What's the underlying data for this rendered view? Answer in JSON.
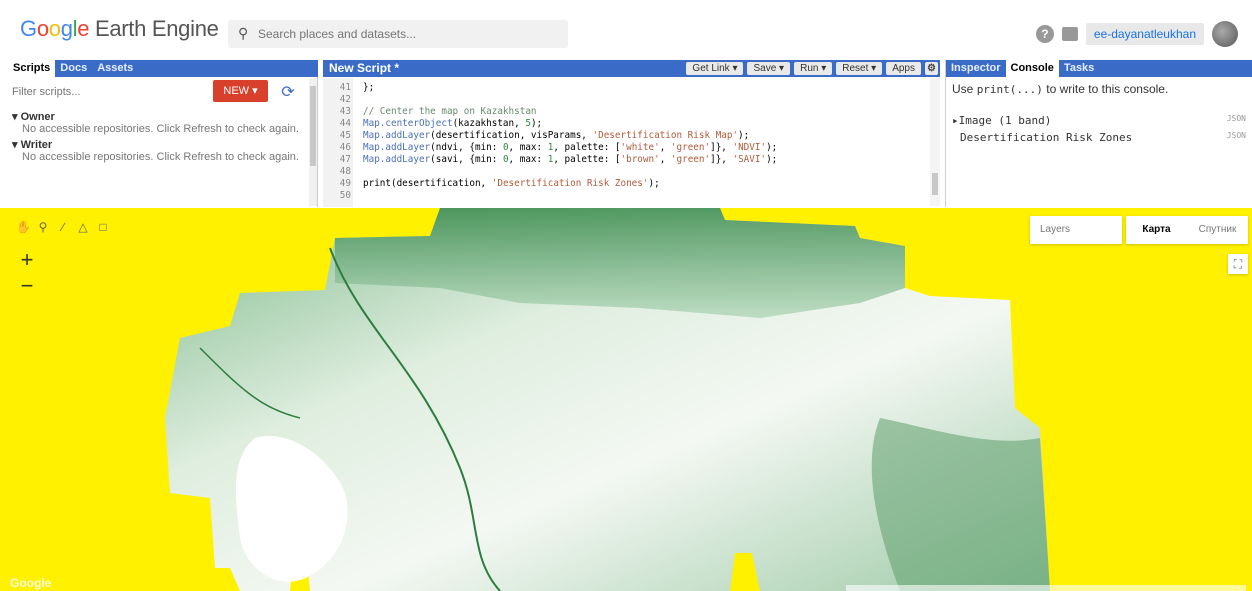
{
  "header": {
    "logo_text": "Google Earth Engine",
    "search_placeholder": "Search places and datasets...",
    "help_label": "?",
    "username": "ee-dayanatleukhan"
  },
  "left_panel": {
    "tabs": [
      "Scripts",
      "Docs",
      "Assets"
    ],
    "active_tab": "Scripts",
    "filter_placeholder": "Filter scripts...",
    "new_button": "NEW ▾",
    "groups": [
      {
        "name": "Owner",
        "note": "No accessible repositories. Click Refresh to check again."
      },
      {
        "name": "Writer",
        "note": "No accessible repositories. Click Refresh to check again."
      }
    ]
  },
  "editor": {
    "title": "New Script *",
    "buttons": [
      "Get Link",
      "Save",
      "Run",
      "Reset",
      "Apps"
    ],
    "lines": [
      {
        "n": "41",
        "code": "};"
      },
      {
        "n": "42",
        "code": ""
      },
      {
        "n": "43",
        "code": "// Center the map on Kazakhstan"
      },
      {
        "n": "44",
        "code": "Map.centerObject(kazakhstan, 5);"
      },
      {
        "n": "45",
        "code": "Map.addLayer(desertification, visParams, 'Desertification Risk Map');"
      },
      {
        "n": "46",
        "code": "Map.addLayer(ndvi, {min: 0, max: 1, palette: ['white', 'green']}, 'NDVI');"
      },
      {
        "n": "47",
        "code": "Map.addLayer(savi, {min: 0, max: 1, palette: ['brown', 'green']}, 'SAVI');"
      },
      {
        "n": "48",
        "code": ""
      },
      {
        "n": "49",
        "code": "print(desertification, 'Desertification Risk Zones');"
      },
      {
        "n": "50",
        "code": ""
      }
    ]
  },
  "right_panel": {
    "tabs": [
      "Inspector",
      "Console",
      "Tasks"
    ],
    "active_tab": "Console",
    "hint_prefix": "Use ",
    "hint_code": "print(...)",
    "hint_suffix": " to write to this console.",
    "logs": [
      {
        "text": "▸Image (1 band)",
        "tag": "JSON"
      },
      {
        "text": "Desertification Risk Zones",
        "tag": "JSON"
      }
    ]
  },
  "map": {
    "layers_label": "Layers",
    "map_types": [
      "Карта",
      "Спутник"
    ],
    "active_map_type": "Карта",
    "zoom_in": "+",
    "zoom_out": "−",
    "watermark": "Google",
    "background_color": "#fff100",
    "layer_color_light": "#eef5ee",
    "layer_color_dark": "#3d8c4f"
  },
  "colors": {
    "panel_header": "#3a6cc7",
    "new_button": "#d9402b"
  }
}
